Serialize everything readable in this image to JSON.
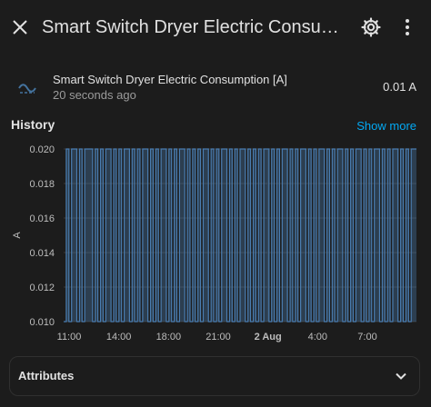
{
  "header": {
    "title": "Smart Switch Dryer Electric Consumption [A]",
    "close_icon": "close-icon",
    "settings_icon": "gear-icon",
    "more_icon": "dots-vertical-icon"
  },
  "entity": {
    "icon": "current-ac-icon",
    "name": "Smart Switch Dryer Electric Consumption [A]",
    "last_changed": "20 seconds ago",
    "state": "0.01 A"
  },
  "history": {
    "title": "History",
    "show_more": "Show more"
  },
  "chart_data": {
    "type": "line",
    "ylabel": "A",
    "ylim": [
      0.01,
      0.02
    ],
    "y_ticks": [
      "0.020",
      "0.018",
      "0.016",
      "0.014",
      "0.012",
      "0.010"
    ],
    "x_ticks": [
      "11:00",
      "14:00",
      "18:00",
      "21:00",
      "2 Aug",
      "4:00",
      "7:00"
    ],
    "x_ticks_bold": [
      false,
      false,
      false,
      false,
      true,
      false,
      false
    ],
    "series": [
      {
        "color": "#4a7db1",
        "values": [
          0.01,
          0.02,
          0.01,
          0.02,
          0.02,
          0.01,
          0.02,
          0.01,
          0.02,
          0.02,
          0.02,
          0.01,
          0.02,
          0.01,
          0.02,
          0.01,
          0.02,
          0.02,
          0.01,
          0.02,
          0.01,
          0.02,
          0.01,
          0.02,
          0.02,
          0.01,
          0.02,
          0.01,
          0.02,
          0.01,
          0.02,
          0.02,
          0.01,
          0.02,
          0.01,
          0.02,
          0.01,
          0.02,
          0.02,
          0.01,
          0.02,
          0.01,
          0.02,
          0.01,
          0.02,
          0.02,
          0.01,
          0.02,
          0.01,
          0.02,
          0.01,
          0.02,
          0.01,
          0.02,
          0.02,
          0.01,
          0.02,
          0.01,
          0.02,
          0.01,
          0.02,
          0.02,
          0.01,
          0.02,
          0.01,
          0.02,
          0.01,
          0.02,
          0.02,
          0.01,
          0.02,
          0.01,
          0.02,
          0.01,
          0.02,
          0.01,
          0.02,
          0.02,
          0.01,
          0.02,
          0.01,
          0.02,
          0.01,
          0.02,
          0.02,
          0.01,
          0.02,
          0.01,
          0.02,
          0.01,
          0.02,
          0.02,
          0.01,
          0.02,
          0.01,
          0.02,
          0.01,
          0.02,
          0.02,
          0.01,
          0.02,
          0.01,
          0.02,
          0.01,
          0.02,
          0.02,
          0.01,
          0.02,
          0.01,
          0.02,
          0.01,
          0.02,
          0.02,
          0.01,
          0.02,
          0.01,
          0.02,
          0.01,
          0.02,
          0.02,
          0.01,
          0.02,
          0.01,
          0.02,
          0.01,
          0.02,
          0.02,
          0.01,
          0.02,
          0.01,
          0.02,
          0.01,
          0.02,
          0.02
        ]
      }
    ],
    "grid": true
  },
  "attributes": {
    "label": "Attributes",
    "chevron_icon": "chevron-down-icon"
  }
}
